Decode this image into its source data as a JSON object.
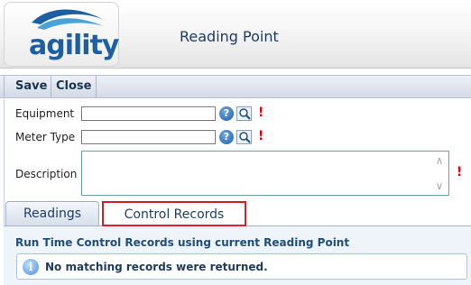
{
  "header": {
    "logo_text": "agility",
    "title": "Reading Point"
  },
  "toolbar": {
    "save_label": "Save",
    "close_label": "Close"
  },
  "form": {
    "equipment_label": "Equipment",
    "equipment_value": "",
    "meter_type_label": "Meter Type",
    "meter_type_value": "",
    "description_label": "Description",
    "description_value": "",
    "help_glyph": "?",
    "required_glyph": "!"
  },
  "tabs": [
    {
      "label": "Readings",
      "selected": false
    },
    {
      "label": "Control Records",
      "selected": true
    }
  ],
  "panel": {
    "title": "Run Time Control Records using current Reading Point",
    "info_glyph": "i",
    "message": "No matching records were returned."
  },
  "icons": {
    "help": "help-icon",
    "lookup": "magnifier-icon",
    "required": "exclamation-icon",
    "info": "info-icon"
  },
  "colors": {
    "required": "#e0001a",
    "brand": "#1d5fa3",
    "selected_tab_outline": "#d8202a"
  }
}
